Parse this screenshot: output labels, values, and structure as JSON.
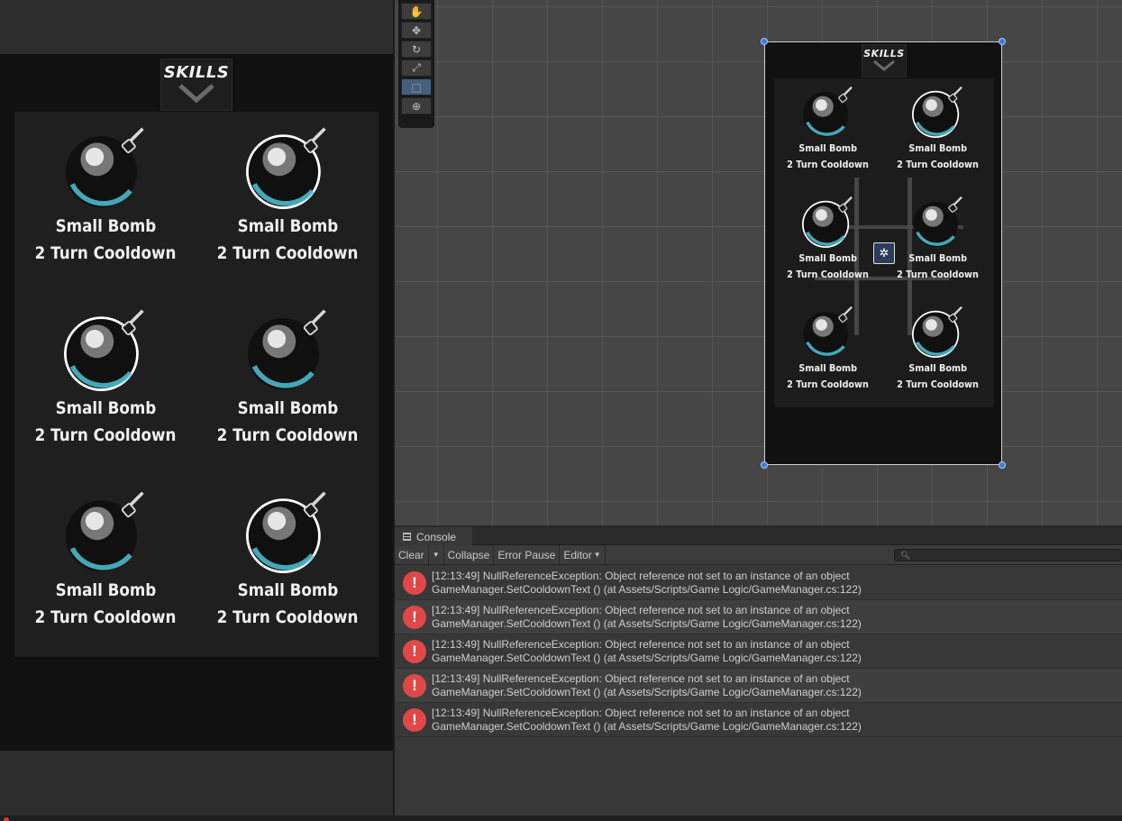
{
  "game_view": {
    "header_title": "SKILLS",
    "skills": [
      {
        "name": "Small Bomb",
        "cooldown": "2 Turn Cooldown",
        "highlighted": false
      },
      {
        "name": "Small Bomb",
        "cooldown": "2 Turn Cooldown",
        "highlighted": true
      },
      {
        "name": "Small Bomb",
        "cooldown": "2 Turn Cooldown",
        "highlighted": true
      },
      {
        "name": "Small Bomb",
        "cooldown": "2 Turn Cooldown",
        "highlighted": false
      },
      {
        "name": "Small Bomb",
        "cooldown": "2 Turn Cooldown",
        "highlighted": false
      },
      {
        "name": "Small Bomb",
        "cooldown": "2 Turn Cooldown",
        "highlighted": true
      }
    ]
  },
  "scene_view": {
    "tools": [
      "hand-tool-icon",
      "move-tool-icon",
      "rotate-tool-icon",
      "scale-tool-icon",
      "rect-tool-icon",
      "transform-tool-icon"
    ],
    "active_tool": "rect-tool-icon",
    "header_title": "SKILLS",
    "skills": [
      {
        "name": "Small Bomb",
        "cooldown": "2 Turn Cooldown",
        "highlighted": false
      },
      {
        "name": "Small Bomb",
        "cooldown": "2 Turn Cooldown",
        "highlighted": true
      },
      {
        "name": "Small Bomb",
        "cooldown": "2 Turn Cooldown",
        "highlighted": true
      },
      {
        "name": "Small Bomb",
        "cooldown": "2 Turn Cooldown",
        "highlighted": false
      },
      {
        "name": "Small Bomb",
        "cooldown": "2 Turn Cooldown",
        "highlighted": false
      },
      {
        "name": "Small Bomb",
        "cooldown": "2 Turn Cooldown",
        "highlighted": true
      }
    ]
  },
  "console": {
    "tab_label": "Console",
    "toolbar": {
      "clear": "Clear",
      "collapse": "Collapse",
      "error_pause": "Error Pause",
      "editor": "Editor"
    },
    "search_placeholder": "",
    "logs": [
      {
        "line1": "[12:13:49] NullReferenceException: Object reference not set to an instance of an object",
        "line2": "GameManager.SetCooldownText () (at Assets/Scripts/Game Logic/GameManager.cs:122)"
      },
      {
        "line1": "[12:13:49] NullReferenceException: Object reference not set to an instance of an object",
        "line2": "GameManager.SetCooldownText () (at Assets/Scripts/Game Logic/GameManager.cs:122)"
      },
      {
        "line1": "[12:13:49] NullReferenceException: Object reference not set to an instance of an object",
        "line2": "GameManager.SetCooldownText () (at Assets/Scripts/Game Logic/GameManager.cs:122)"
      },
      {
        "line1": "[12:13:49] NullReferenceException: Object reference not set to an instance of an object",
        "line2": "GameManager.SetCooldownText () (at Assets/Scripts/Game Logic/GameManager.cs:122)"
      },
      {
        "line1": "[12:13:49] NullReferenceException: Object reference not set to an instance of an object",
        "line2": "GameManager.SetCooldownText () (at Assets/Scripts/Game Logic/GameManager.cs:122)"
      }
    ]
  },
  "colors": {
    "error_red": "#e04848",
    "selection_blue": "#3c7bd8",
    "bomb_glow": "#4fc3d6"
  }
}
